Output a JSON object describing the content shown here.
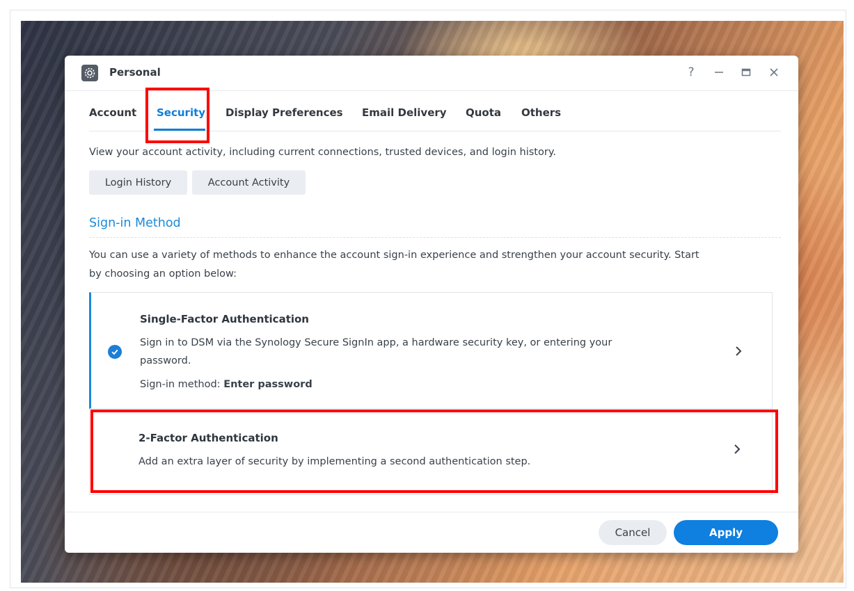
{
  "window": {
    "title": "Personal",
    "icon": "gear-icon",
    "controls": {
      "help": "?",
      "minimize": "minimize-icon",
      "maximize": "maximize-icon",
      "close": "close-icon"
    }
  },
  "tabs": [
    {
      "label": "Account",
      "active": false
    },
    {
      "label": "Security",
      "active": true
    },
    {
      "label": "Display Preferences",
      "active": false
    },
    {
      "label": "Email Delivery",
      "active": false
    },
    {
      "label": "Quota",
      "active": false
    },
    {
      "label": "Others",
      "active": false
    }
  ],
  "activity": {
    "description": "View your account activity, including current connections, trusted devices, and login history.",
    "buttons": [
      "Login History",
      "Account Activity"
    ]
  },
  "signin": {
    "heading": "Sign-in Method",
    "intro_line1": "You can use a variety of methods to enhance the account sign-in experience and strengthen your account security. Start",
    "intro_line2": "by choosing an option below:",
    "options": [
      {
        "title": "Single-Factor Authentication",
        "desc_line1": "Sign in to DSM via the Synology Secure SignIn app, a hardware security key, or entering your",
        "desc_line2": "password.",
        "method_label": "Sign-in method: ",
        "method_value": "Enter password",
        "selected": true
      },
      {
        "title": "2-Factor Authentication",
        "desc_line1": "Add an extra layer of security by implementing a second authentication step.",
        "selected": false
      }
    ]
  },
  "footer": {
    "cancel": "Cancel",
    "apply": "Apply"
  },
  "colors": {
    "accent": "#0f7dd9",
    "highlight": "#ff0000"
  }
}
